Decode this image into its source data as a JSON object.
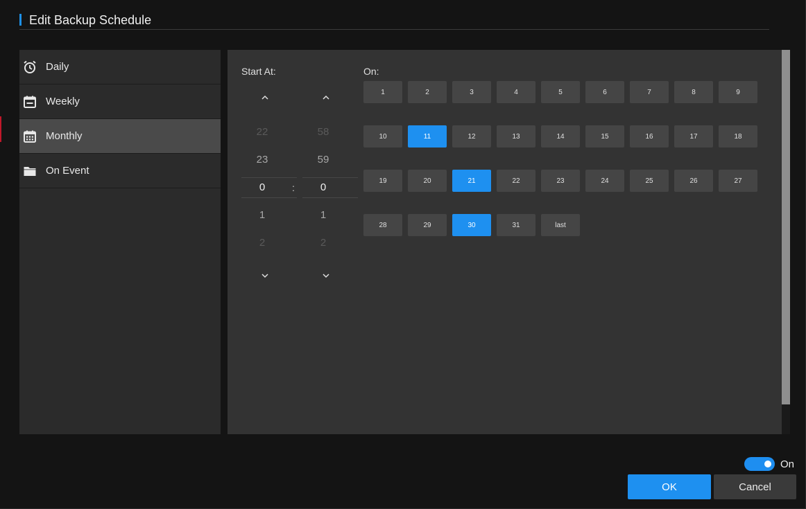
{
  "window": {
    "title": "Edit Backup Schedule"
  },
  "sidebar": {
    "items": [
      {
        "label": "Daily",
        "icon": "alarm-clock-icon",
        "active": false
      },
      {
        "label": "Weekly",
        "icon": "calendar-week-icon",
        "active": false
      },
      {
        "label": "Monthly",
        "icon": "calendar-month-icon",
        "active": true
      },
      {
        "label": "On Event",
        "icon": "folder-icon",
        "active": false
      }
    ]
  },
  "start_at": {
    "label": "Start At:",
    "hours": {
      "prev2": "22",
      "prev1": "23",
      "current": "0",
      "next1": "1",
      "next2": "2"
    },
    "separator": ":",
    "minutes": {
      "prev2": "58",
      "prev1": "59",
      "current": "0",
      "next1": "1",
      "next2": "2"
    }
  },
  "on": {
    "label": "On:",
    "days": [
      "1",
      "2",
      "3",
      "4",
      "5",
      "6",
      "7",
      "8",
      "9",
      "10",
      "11",
      "12",
      "13",
      "14",
      "15",
      "16",
      "17",
      "18",
      "19",
      "20",
      "21",
      "22",
      "23",
      "24",
      "25",
      "26",
      "27",
      "28",
      "29",
      "30",
      "31",
      "last"
    ],
    "selected": [
      "11",
      "21",
      "30"
    ]
  },
  "footer": {
    "toggle_label": "On",
    "toggle_on": true,
    "ok_label": "OK",
    "cancel_label": "Cancel"
  },
  "colors": {
    "accent": "#1e90f0",
    "selected_day": "#1e90f0",
    "sidebar_active": "#4a4a4a"
  }
}
